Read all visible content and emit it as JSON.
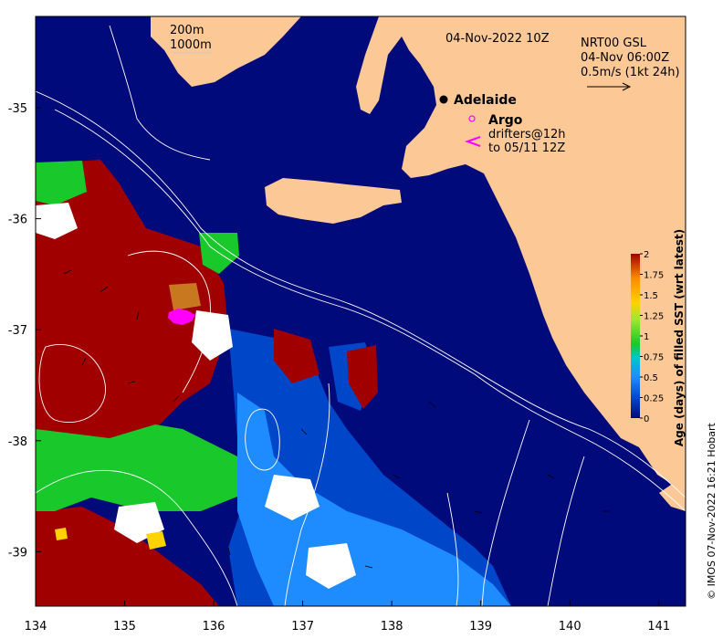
{
  "map": {
    "date_title": "04-Nov-2022 10Z",
    "product": {
      "line1": "NRT00 GSL",
      "line2": "04-Nov 06:00Z",
      "line3": "0.5m/s (1kt 24h)"
    },
    "contour_legend": [
      "200m",
      "1000m"
    ],
    "places": [
      {
        "name": "Adelaide",
        "lon": 138.55,
        "lat": -34.92
      }
    ],
    "legend": {
      "argo": "Argo",
      "drifters_line1": "drifters@12h",
      "drifters_line2": "to 05/11 12Z"
    },
    "x_ticks": [
      "134",
      "135",
      "136",
      "137",
      "138",
      "139",
      "140",
      "141"
    ],
    "y_ticks": [
      "-35",
      "-36",
      "-37",
      "-38",
      "-39"
    ],
    "colorbar": {
      "label": "Age (days) of filled SST (wrt latest)",
      "ticks": [
        "2",
        "1.75",
        "1.5",
        "1.25",
        "1",
        "0.75",
        "0.5",
        "0.25",
        "0"
      ],
      "range": [
        0,
        2
      ]
    },
    "credit": "© IMOS 07-Nov-2022 16:21 Hobart",
    "colors": {
      "ocean_recent": "#000a7a",
      "land": "#fbc896",
      "age_0_25": "#0046c8",
      "age_0_5": "#1e8cff",
      "age_1": "#19c82a",
      "age_1_5": "#ffd200",
      "age_2": "#a00000",
      "drifter": "#ff00ff"
    }
  }
}
